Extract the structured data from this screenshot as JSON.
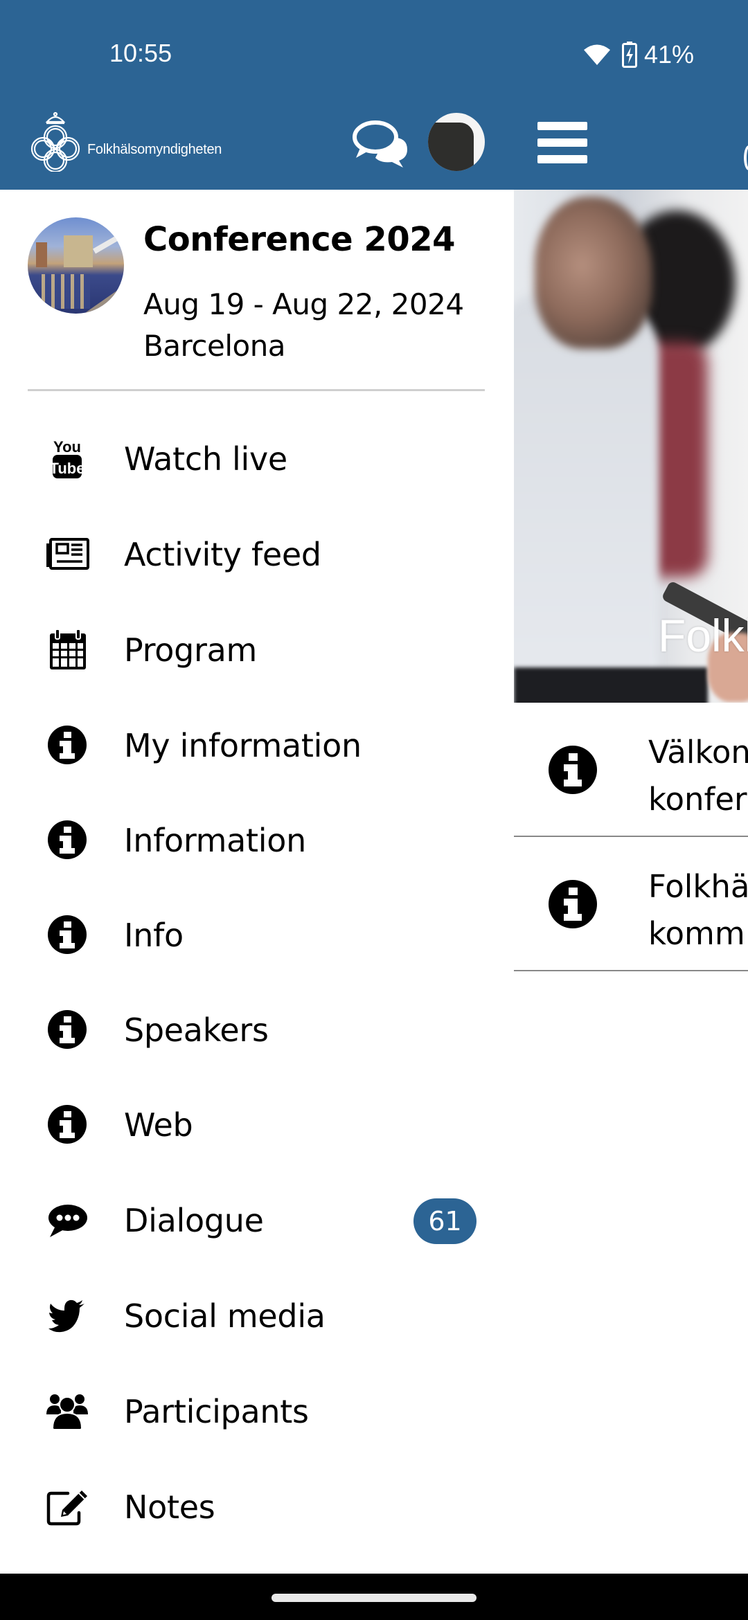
{
  "status_bar": {
    "time": "10:55",
    "battery": "41%",
    "icons": [
      "wifi-icon",
      "battery-charging-icon"
    ]
  },
  "header": {
    "logo_text": "Folkhälsomyndigheten",
    "brand_color": "#2C6494",
    "icons": [
      "chat-icon",
      "profile-avatar",
      "hamburger-menu-icon"
    ]
  },
  "drawer": {
    "event": {
      "title": "Conference 2024",
      "dates": "Aug 19 - Aug 22, 2024",
      "location": "Barcelona"
    },
    "items": [
      {
        "label": "Watch live",
        "icon": "youtube-icon"
      },
      {
        "label": "Activity feed",
        "icon": "newspaper-icon"
      },
      {
        "label": "Program",
        "icon": "calendar-icon"
      },
      {
        "label": "My information",
        "icon": "info-icon"
      },
      {
        "label": "Information",
        "icon": "info-icon"
      },
      {
        "label": "Info",
        "icon": "info-icon"
      },
      {
        "label": "Speakers",
        "icon": "info-icon"
      },
      {
        "label": "Web",
        "icon": "info-icon"
      },
      {
        "label": "Dialogue",
        "icon": "speech-bubble-icon",
        "badge": "61"
      },
      {
        "label": "Social media",
        "icon": "twitter-icon"
      },
      {
        "label": "Participants",
        "icon": "users-icon"
      },
      {
        "label": "Notes",
        "icon": "edit-icon"
      }
    ]
  },
  "content": {
    "hero_title": "Folkh",
    "news": [
      {
        "line1": "Välkon",
        "line2": "konfer"
      },
      {
        "line1": "Folkhä",
        "line2": "komm"
      }
    ]
  }
}
